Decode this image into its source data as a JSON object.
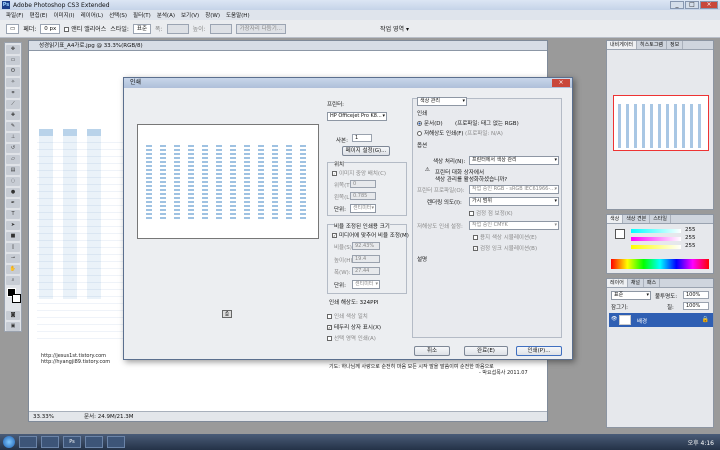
{
  "app": {
    "title": "Adobe Photoshop CS3 Extended",
    "icon": "Ps",
    "window_controls": [
      "_",
      "□",
      "×"
    ]
  },
  "menu": [
    "파일(F)",
    "편집(E)",
    "이미지(I)",
    "레이어(L)",
    "선택(S)",
    "필터(T)",
    "분석(A)",
    "보기(V)",
    "창(W)",
    "도움말(H)"
  ],
  "options": {
    "feather_label": "페더:",
    "feather_value": "0 px",
    "antialias": "앤티 앨리어스",
    "style_label": "스타일:",
    "style_value": "표준",
    "width_label": "폭:",
    "height_label": "높이:",
    "refine_button": "가장자리 다듬기...",
    "workspace": "작업 영역 ▾"
  },
  "document": {
    "tab": "성경읽기표_A4가로.jpg @ 33.3%(RGB/8)",
    "zoom": "33.33%",
    "doc_info": "문서: 24.9M/21.3M",
    "urls": [
      "http://jesus1st.tistory.com",
      "http://hyangji89.tistory.com"
    ],
    "footer_text": "기도: 하나님께 사랑으로 순전히 마음 모든 시작 말을 말씀이여 순전한 마음으로",
    "footer_sign": "- 박요섭목사 2011.07"
  },
  "dialog": {
    "title": "인쇄",
    "close": "×",
    "printer_label": "프린터:",
    "printer_value": "HP Officejet Pro K8...",
    "copies_label": "사본:",
    "copies_value": "1",
    "page_setup": "페이지 설정(G)...",
    "position_header": "위치",
    "center_image": "이미지 중앙 배치(C)",
    "top_label": "위쪽(T):",
    "top_value": "0",
    "left_label": "왼쪽(L):",
    "left_value": "0.785",
    "unit_label": "단위:",
    "unit_value": "센티미터",
    "scaled_header": "비율 조정된 인쇄용 크기",
    "scale_to_media": "미디어에 맞추어 비율 조정(M)",
    "scale_label": "비율(S):",
    "scale_value": "92.43%",
    "height_label": "높이(H):",
    "height_value": "19.4",
    "width_label": "폭(W):",
    "width_value": "27.44",
    "unit2_label": "단위:",
    "unit2_value": "센티미터",
    "resolution": "인쇄 해상도: 324PPI",
    "print_color": "인쇄 색상 일치",
    "bounding_box": "테두리 상자 표시(X)",
    "print_selection": "선택 영역 인쇄(A)",
    "color_mgmt": "색상 관리",
    "print_header": "인쇄",
    "doc_radio": "문서(D)",
    "doc_profile": "(프로파일: 태그 없는 RGB)",
    "proof_radio": "저해상도 인쇄(F)",
    "proof_profile": "(프로파일: N/A)",
    "options_header": "옵션",
    "color_handling_label": "색상 처리(N):",
    "color_handling_value": "프린터에서 색상 관리",
    "warning_line1": "프린터 대화 상자에서",
    "warning_line2": "색상 관리를 활성화하셨습니까?",
    "printer_profile_label": "프린터 프로파일(O):",
    "printer_profile_value": "작업 중인 RGB - sRGB IEC61966-...",
    "intent_label": "렌더링 의도(I):",
    "intent_value": "가시 범위",
    "black_point": "검정 점 보정(K)",
    "proof_setup_label": "저해상도 인쇄 설정:",
    "proof_setup_value": "작업 중인 CMYK",
    "sim_paper": "용지 색상 시뮬레이션(E)",
    "sim_black": "검정 잉크 시뮬레이션(B)",
    "description_header": "설명",
    "cancel": "취소",
    "done": "완료(E)",
    "print": "인쇄(P)..."
  },
  "panels": {
    "navigator_tabs": [
      "내비게이터",
      "히스토그램",
      "정보"
    ],
    "color_tabs": [
      "색상",
      "색상 견본",
      "스타일"
    ],
    "color_values": [
      "255",
      "255",
      "255"
    ],
    "layers_tabs": [
      "레이어",
      "채널",
      "패스"
    ],
    "blend_mode": "표준",
    "opacity_label": "불투명도:",
    "opacity_value": "100%",
    "lock_label": "잠그기:",
    "fill_label": "칠:",
    "fill_value": "100%",
    "layer_name": "배경"
  },
  "taskbar": {
    "clock": "오후 4:16",
    "items": [
      "",
      "",
      "Ps",
      "",
      ""
    ]
  }
}
